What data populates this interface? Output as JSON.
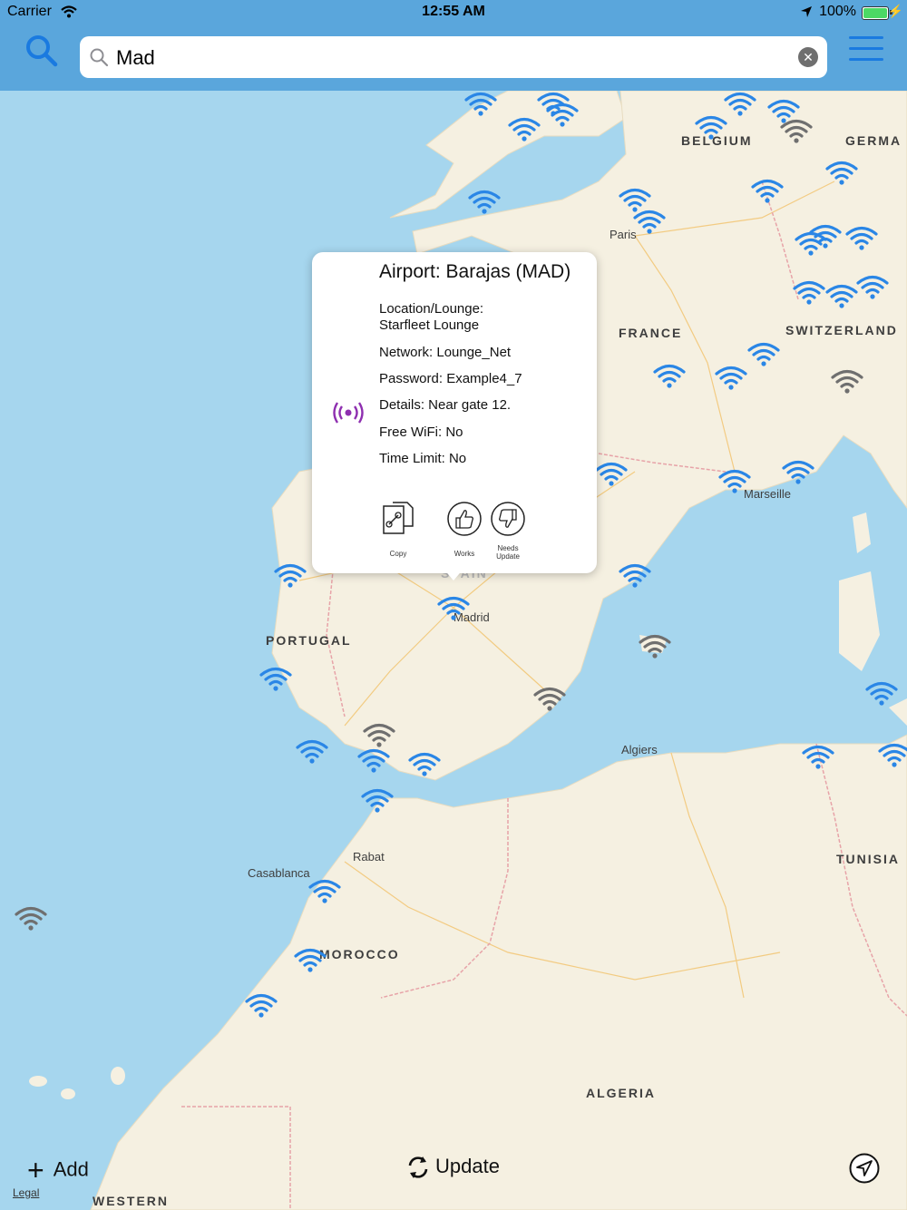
{
  "status_bar": {
    "carrier": "Carrier",
    "time": "12:55 AM",
    "battery": "100%"
  },
  "search": {
    "value": "Mad",
    "placeholder": ""
  },
  "map": {
    "countries": [
      "BELGIUM",
      "GERMA",
      "FRANCE",
      "SWITZERLAND",
      "SPAIN",
      "PORTUGAL",
      "MOROCCO",
      "TUNISIA",
      "ALGERIA",
      "WESTERN"
    ],
    "cities": [
      "Paris",
      "Marseille",
      "Madrid",
      "Algiers",
      "Rabat",
      "Casablanca"
    ]
  },
  "popup": {
    "title": "Airport: Barajas (MAD)",
    "location_label": "Location/Lounge:",
    "location_value": "Starfleet Lounge",
    "network": "Network: Lounge_Net",
    "password": "Password: Example4_7",
    "details": "Details: Near gate 12.",
    "free_wifi": "Free WiFi: No",
    "time_limit": "Time Limit: No",
    "actions": {
      "copy": "Copy",
      "works": "Works",
      "needs_update_1": "Needs",
      "needs_update_2": "Update"
    }
  },
  "toolbar": {
    "add": "Add",
    "update": "Update",
    "legal": "Legal"
  },
  "colors": {
    "header": "#5aa6dc",
    "accent": "#1a7ae0",
    "water": "#a6d6ee",
    "land": "#f5f0e1",
    "pin_blue": "#2a86e6",
    "pin_grey": "#6f6f6f",
    "radio_purple": "#8e2fb0"
  }
}
